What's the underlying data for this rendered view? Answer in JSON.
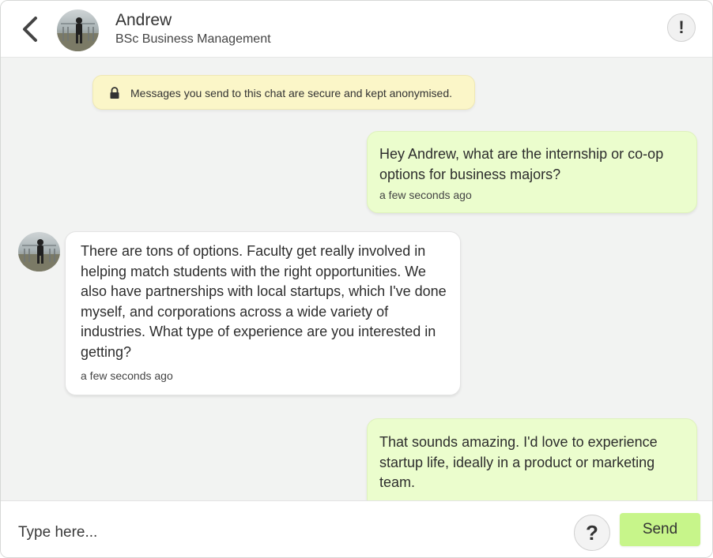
{
  "header": {
    "name": "Andrew",
    "subtitle": "BSc Business Management",
    "report_symbol": "!"
  },
  "notice": {
    "text": "Messages you send to this chat are secure and kept anonymised."
  },
  "messages": [
    {
      "direction": "sent",
      "text": "Hey Andrew, what are the internship or co-op options for business majors?",
      "time": "a few seconds ago"
    },
    {
      "direction": "received",
      "text": "There are tons of options. Faculty get really involved in helping match students with the right opportunities. We also have partnerships with local startups, which I've done myself, and corporations across a wide variety of industries. What type of experience are you interested in getting?",
      "time": "a few seconds ago"
    },
    {
      "direction": "sent",
      "text": "That sounds amazing. I'd love to experience startup life, ideally in a product or marketing team.",
      "time": ""
    }
  ],
  "composer": {
    "placeholder": "Type here...",
    "help_symbol": "?",
    "send_label": "Send"
  },
  "colors": {
    "sent_bubble": "#ebfdcd",
    "received_bubble": "#ffffff",
    "notice_bg": "#fbf6c8",
    "send_button": "#c7f58a",
    "chat_bg": "#f2f3f2"
  },
  "icons": {
    "back": "chevron-left-icon",
    "lock": "lock-icon",
    "report": "exclamation-icon",
    "help": "question-icon"
  }
}
